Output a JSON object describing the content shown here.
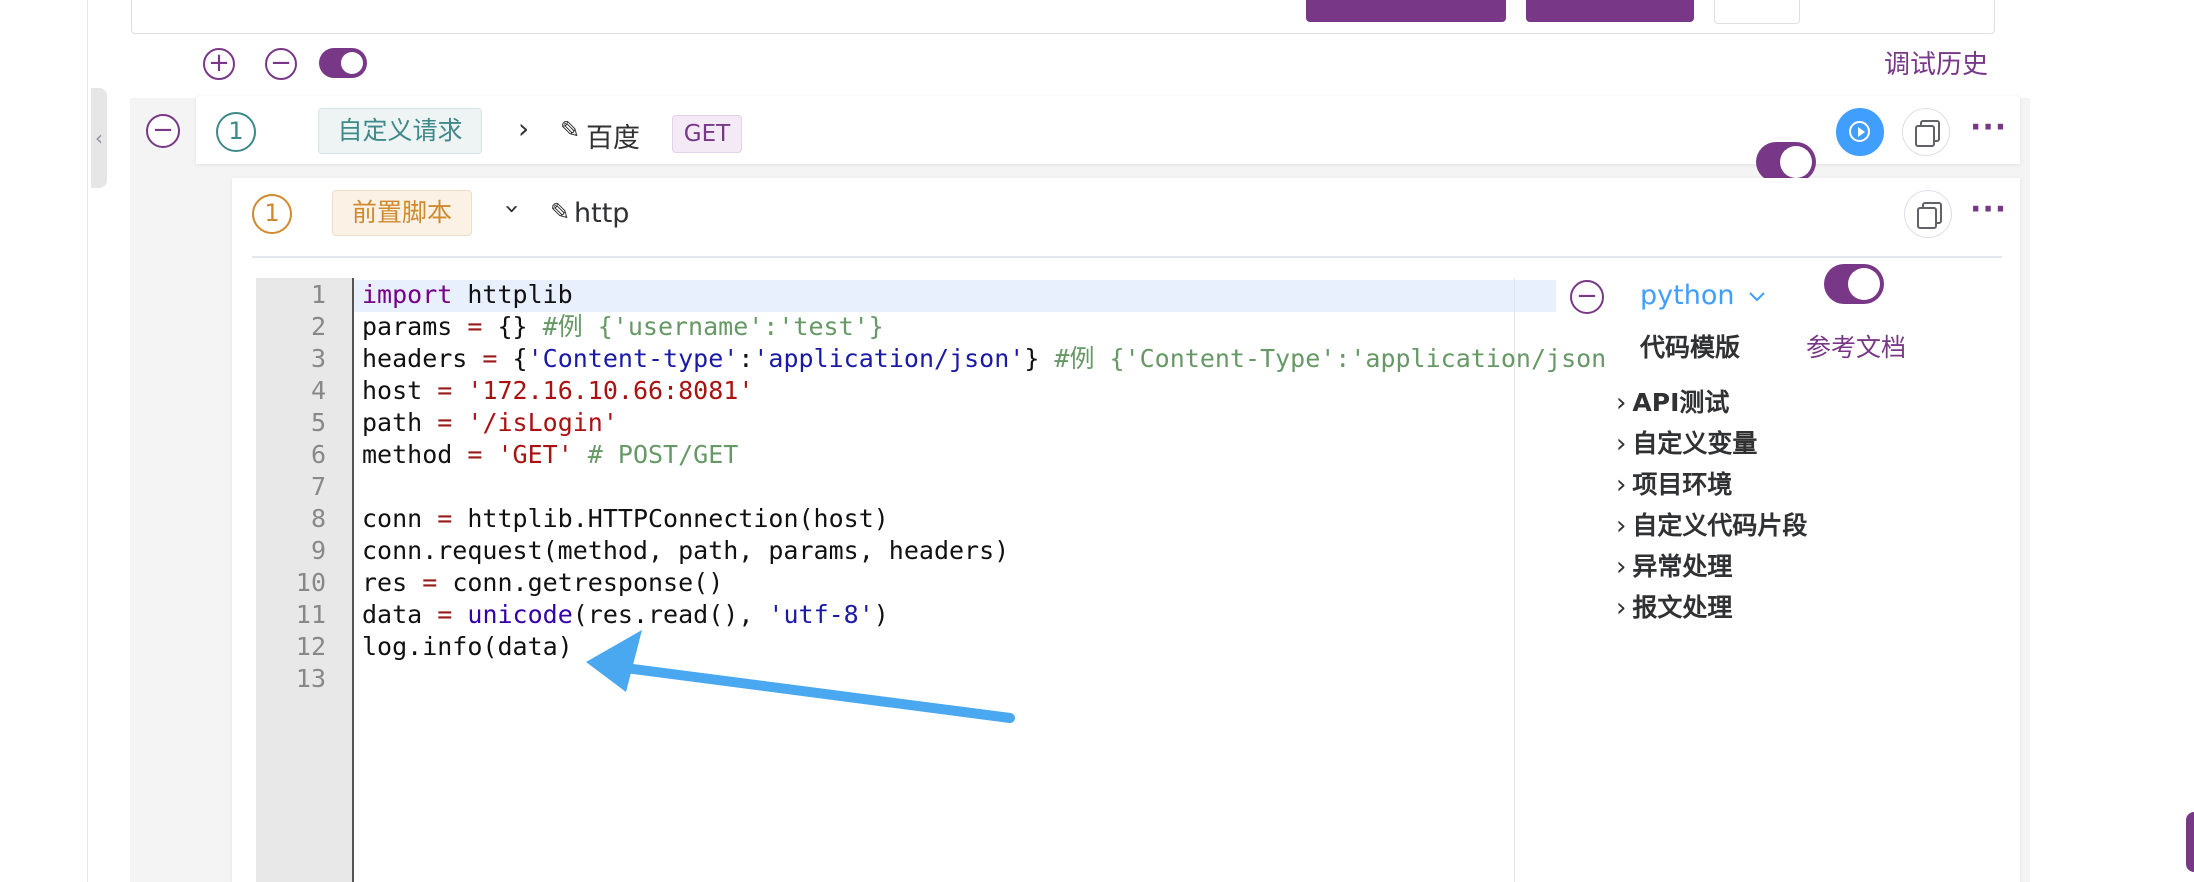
{
  "toolbar": {
    "clipped": true
  },
  "controls": {
    "history_link": "调试历史"
  },
  "request_step": {
    "index": "1",
    "type_tag": "自定义请求",
    "name": "百度",
    "method": "GET"
  },
  "script_step": {
    "index": "1",
    "type_tag": "前置脚本",
    "name": "http"
  },
  "editor": {
    "line_numbers": [
      "1",
      "2",
      "3",
      "4",
      "5",
      "6",
      "7",
      "8",
      "9",
      "10",
      "11",
      "12",
      "13"
    ],
    "language": "python"
  },
  "side_panel": {
    "template_label": "代码模版",
    "docs_link": "参考文档",
    "tree": [
      "API测试",
      "自定义变量",
      "项目环境",
      "自定义代码片段",
      "异常处理",
      "报文处理"
    ]
  },
  "colors": {
    "brand": "#783887",
    "arrow": "#4aa8f0",
    "teal": "#3e8a8a",
    "orange": "#d08a2e"
  }
}
